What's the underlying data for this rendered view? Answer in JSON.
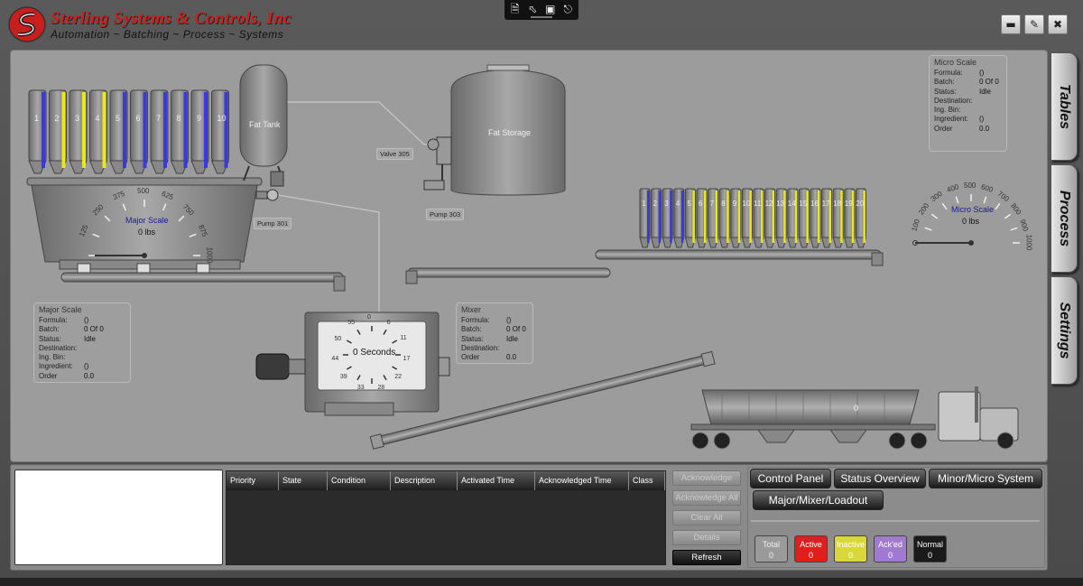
{
  "header": {
    "company": "Sterling Systems & Controls, Inc",
    "tagline": "Automation ~ Batching ~ Process ~ Systems"
  },
  "toolbar": {
    "icons": [
      "doc-add-icon",
      "pointer-select-icon",
      "frame-icon",
      "network-icon"
    ]
  },
  "window_buttons": {
    "icons": [
      "minimize-icon",
      "edit-icon",
      "close-icon"
    ]
  },
  "side_tabs": [
    "Tables",
    "Process",
    "Settings"
  ],
  "process": {
    "major_bins": [
      "1",
      "2",
      "3",
      "4",
      "5",
      "6",
      "7",
      "8",
      "9",
      "10"
    ],
    "major_bin_colors": [
      "#3a3ad8",
      "#e8e820",
      "#e8e820",
      "#e8e820",
      "#3a3ad8",
      "#3a3ad8",
      "#3a3ad8",
      "#3a3ad8",
      "#3a3ad8",
      "#3a3ad8"
    ],
    "minor_bins": [
      "1",
      "2",
      "3",
      "4",
      "5",
      "6",
      "7",
      "8",
      "9",
      "10",
      "11",
      "12",
      "13",
      "14",
      "15",
      "16",
      "17",
      "18",
      "19",
      "20"
    ],
    "minor_bin_colors": [
      "#3a3ad8",
      "#3a3ad8",
      "#3a3ad8",
      "#3a3ad8",
      "#e8e820",
      "#e8e820",
      "#e8e820",
      "#e8e820",
      "#e8e820",
      "#e8e820",
      "#e8e820",
      "#e8e820",
      "#e8e820",
      "#e8e820",
      "#e8e820",
      "#e8e820",
      "#e8e820",
      "#e8e820",
      "#e8e820",
      "#e8e820"
    ],
    "fat_tank": "Fat Tank",
    "fat_storage": "Fat Storage",
    "valve": "Valve 305",
    "pump301": "Pump 301",
    "pump303": "Pump 303",
    "major_gauge": {
      "title": "Major Scale",
      "value": "0 lbs",
      "ticks": [
        "125",
        "250",
        "375",
        "500",
        "625",
        "750",
        "875",
        "1000"
      ]
    },
    "micro_gauge": {
      "title": "Micro Scale",
      "value": "0 lbs",
      "ticks": [
        "100",
        "200",
        "300",
        "400",
        "500",
        "600",
        "700",
        "800",
        "900",
        "1000"
      ]
    },
    "mixer_timer": {
      "value": "0 Seconds",
      "ticks": [
        "0",
        "6",
        "11",
        "17",
        "22",
        "28",
        "33",
        "39",
        "44",
        "50",
        "55"
      ]
    },
    "truck_value": "0"
  },
  "micro_panel": {
    "title": "Micro Scale",
    "rows": [
      {
        "k": "Formula:",
        "v": "()"
      },
      {
        "k": "Batch:",
        "v": "0 Of 0"
      },
      {
        "k": "Status:",
        "v": "Idle"
      },
      {
        "k": "Destination:",
        "v": ""
      },
      {
        "k": "Ing. Bin:",
        "v": ""
      },
      {
        "k": "Ingredient:",
        "v": "()"
      },
      {
        "k": "Order",
        "v": "0.0"
      }
    ]
  },
  "major_panel": {
    "title": "Major Scale",
    "rows": [
      {
        "k": "Formula:",
        "v": "()"
      },
      {
        "k": "Batch:",
        "v": "0 Of 0"
      },
      {
        "k": "Status:",
        "v": "Idle"
      },
      {
        "k": "Destination:",
        "v": ""
      },
      {
        "k": "Ing. Bin:",
        "v": ""
      },
      {
        "k": "Ingredient:",
        "v": "()"
      },
      {
        "k": "Order",
        "v": "0.0"
      }
    ]
  },
  "mixer_panel": {
    "title": "Mixer",
    "rows": [
      {
        "k": "Formula:",
        "v": "()"
      },
      {
        "k": "Batch:",
        "v": "0 Of 0"
      },
      {
        "k": "Status:",
        "v": "Idle"
      },
      {
        "k": "Destination:",
        "v": ""
      },
      {
        "k": "Order",
        "v": "0.0"
      }
    ]
  },
  "alarms": {
    "columns": [
      "Priority",
      "State",
      "Condition",
      "Description",
      "Activated Time",
      "Acknowledged Time",
      "Class"
    ],
    "buttons": [
      "Acknowledge",
      "Acknowledge All",
      "Clear All",
      "Details",
      "Refresh"
    ]
  },
  "nav": {
    "buttons": [
      "Control Panel",
      "Status Overview",
      "Minor/Micro System",
      "Major/Mixer/Loadout"
    ]
  },
  "counters": [
    {
      "label": "Total",
      "value": "0",
      "bg": "#9a9a9a",
      "fg": "#eee"
    },
    {
      "label": "Active",
      "value": "0",
      "bg": "#e01e1e",
      "fg": "#fff"
    },
    {
      "label": "Inactive",
      "value": "0",
      "bg": "#d8d83a",
      "fg": "#fff"
    },
    {
      "label": "Ack'ed",
      "value": "0",
      "bg": "#a07ad0",
      "fg": "#fff"
    },
    {
      "label": "Normal",
      "value": "0",
      "bg": "#1a1a1a",
      "fg": "#fff"
    }
  ]
}
